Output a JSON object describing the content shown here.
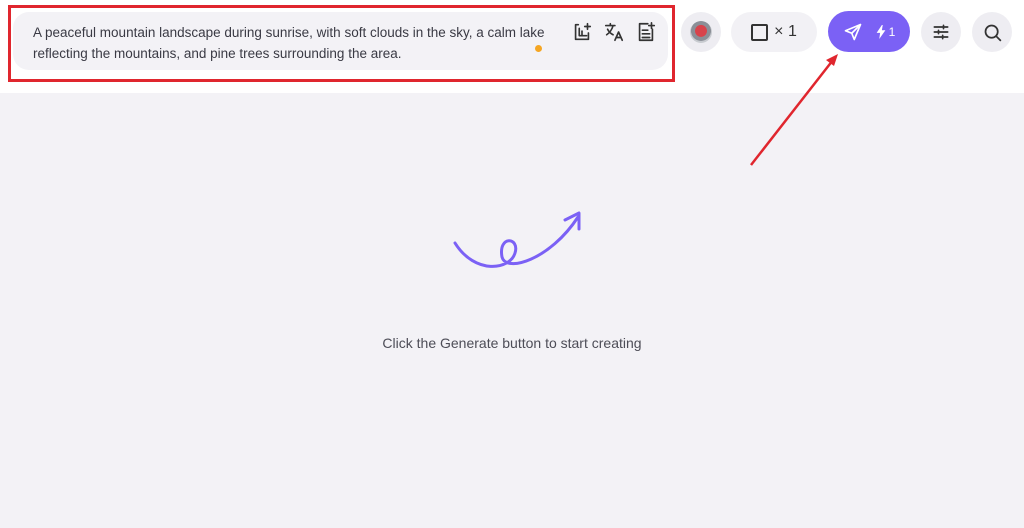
{
  "prompt": {
    "text": "A peaceful mountain landscape during sunrise, with soft clouds in the sky, a calm lake reflecting the mountains, and pine trees surrounding the area."
  },
  "toolbar": {
    "image_count_label": "× 1",
    "generate_cost_label": "1"
  },
  "canvas": {
    "empty_message": "Click the Generate button to start creating"
  },
  "colors": {
    "accent": "#7b61f5",
    "highlight": "#e0262e",
    "dot": "#f5a623"
  },
  "icons": [
    "add-image-icon",
    "translate-icon",
    "prompt-template-icon",
    "send-icon",
    "lightning-icon",
    "sliders-icon",
    "search-icon"
  ]
}
